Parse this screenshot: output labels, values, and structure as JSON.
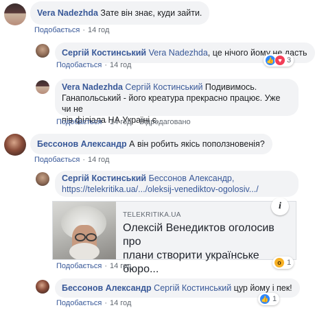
{
  "colors": {
    "link": "#385898",
    "bubble": "#f2f3f5",
    "meta": "#606770"
  },
  "comments": [
    {
      "author": "Vera Nadezhda",
      "text": "Зате він знає, куди зайти.",
      "like_label": "Подобається",
      "time": "14 год"
    },
    {
      "author": "Сергій Костинський",
      "mention": "Vera Nadezhda",
      "text": ", це нічого йому не дасть",
      "like_label": "Подобається",
      "time": "14 год",
      "reaction_count": "3"
    },
    {
      "author": "Vera Nadezhda",
      "mention": "Сергій Костинський",
      "text": " Подивимось.",
      "line2": "Ганапольський - його креатура прекрасно працює. Уже чи не",
      "line3": "пів філіала НА Україні є.",
      "like_label": "Подобається",
      "time": "14 год",
      "edited": "Відредаговано"
    },
    {
      "author": "Бессонов Александр",
      "text": "А він робить якісь поползновенія?",
      "like_label": "Подобається",
      "time": "14 год"
    },
    {
      "author": "Сергій Костинський",
      "mention": "Бессонов Александр,",
      "link": "https://telekritika.ua/.../oleksij-venediktov-ogolosiv.../",
      "like_label": "Подобається",
      "time": "14 год",
      "reaction_count": "1",
      "card": {
        "domain": "TELEKRITIKA.UA",
        "title_line1": "Олексій Венедиктов оголосив про",
        "title_line2": "плани створити українське бюро..."
      }
    },
    {
      "author": "Бессонов Александр",
      "mention": "Сергій Костинський",
      "text": " цур йому і пек!",
      "like_label": "Подобається",
      "time": "14 год",
      "reaction_count": "1"
    }
  ],
  "icons": {
    "reaction_like": "thumbs-up-icon",
    "reaction_love": "heart-icon",
    "reaction_wow": "wow-icon",
    "info": "info-icon"
  }
}
